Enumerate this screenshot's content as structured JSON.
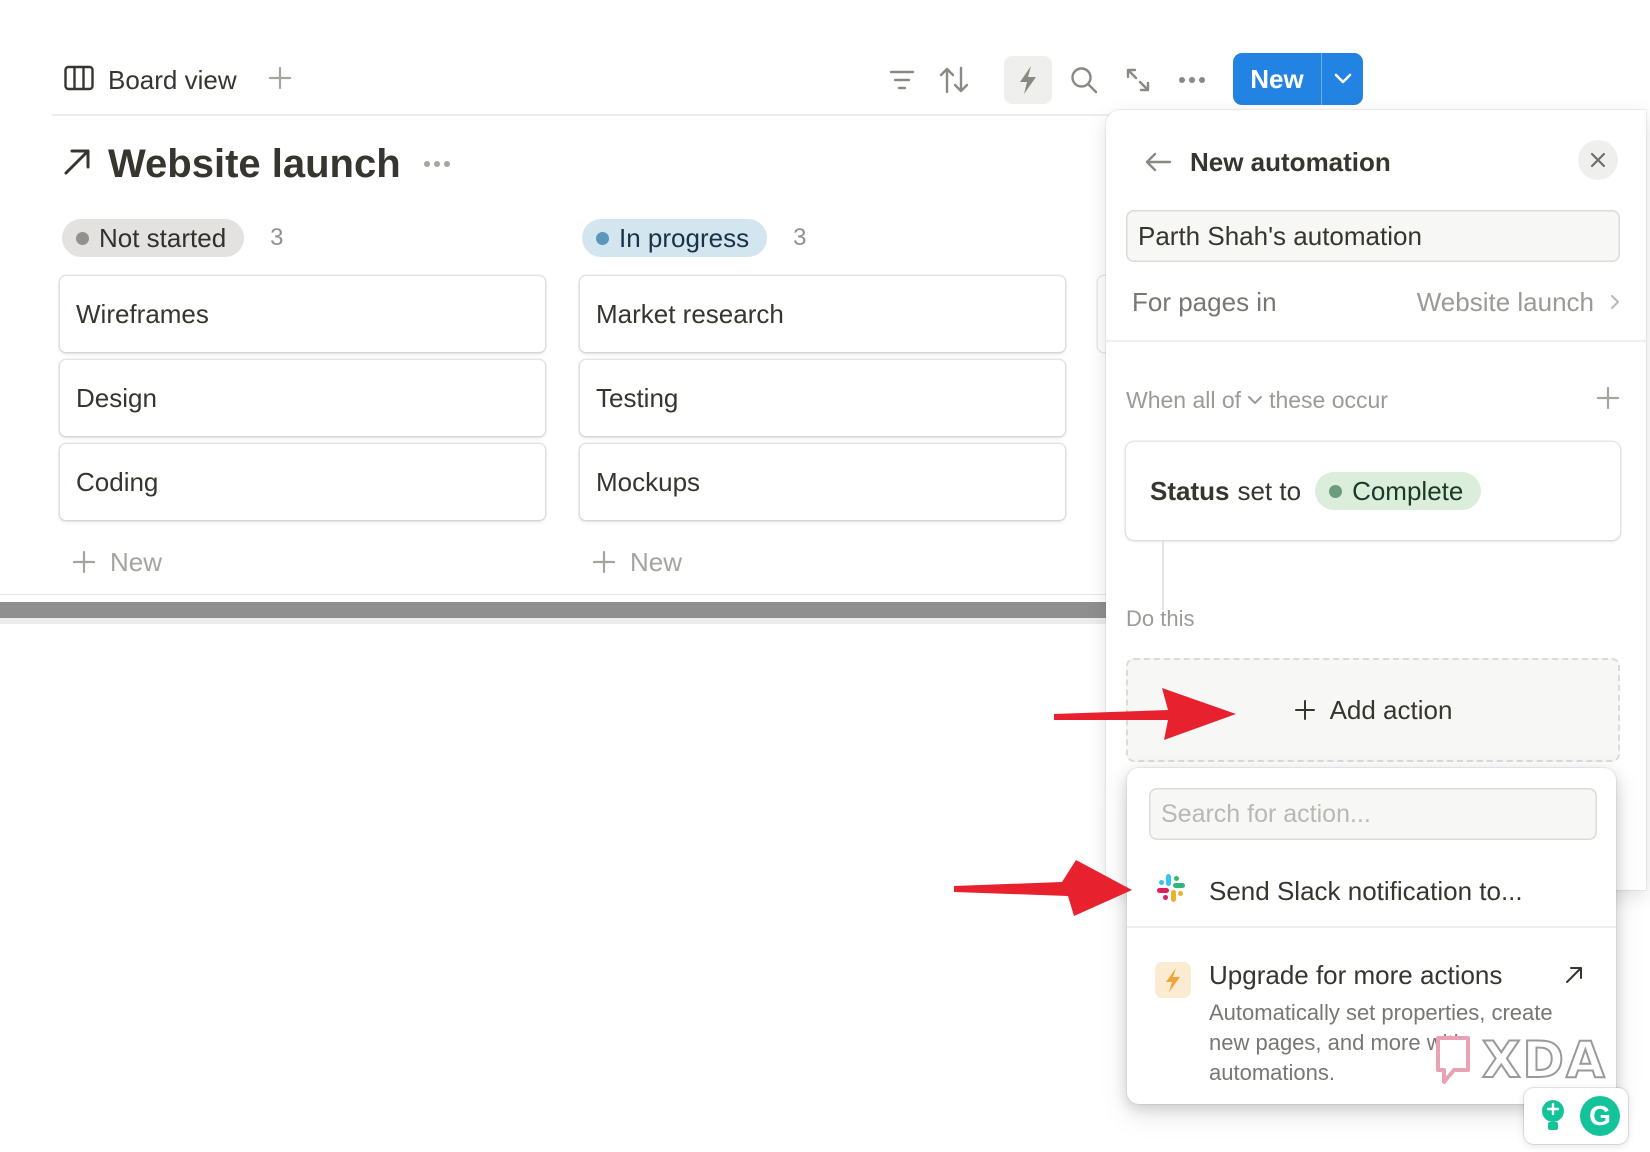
{
  "toolbar": {
    "view_label": "Board view",
    "new_label": "New",
    "icons": [
      "filter-icon",
      "sort-icon",
      "lightning-icon",
      "search-icon",
      "expand-icon",
      "more-icon"
    ]
  },
  "board": {
    "title": "Website launch",
    "columns": [
      {
        "status": "Not started",
        "count": "3",
        "cards": [
          "Wireframes",
          "Design",
          "Coding"
        ],
        "new_label": "New"
      },
      {
        "status": "In progress",
        "count": "3",
        "cards": [
          "Market research",
          "Testing",
          "Mockups"
        ],
        "new_label": "New"
      }
    ]
  },
  "automation": {
    "title": "New automation",
    "name_value": "Parth Shah's automation",
    "for_pages_label": "For pages in",
    "for_pages_value": "Website launch",
    "trigger_prefix": "When all of",
    "trigger_suffix": "these occur",
    "condition_property": "Status",
    "condition_op": "set to",
    "condition_value": "Complete",
    "do_this_label": "Do this",
    "add_action_label": "Add action"
  },
  "action_menu": {
    "search_placeholder": "Search for action...",
    "slack_label": "Send Slack notification to...",
    "upgrade_title": "Upgrade for more actions",
    "upgrade_desc": "Automatically set properties, create new pages, and more with automations."
  },
  "watermark": "XDA",
  "colors": {
    "accent_blue": "#2383e2",
    "annotation_red": "#e8212e",
    "complete_green": "#dbeddb",
    "in_progress_blue": "#d3e5ef",
    "not_started_gray": "#e3e2e0"
  }
}
